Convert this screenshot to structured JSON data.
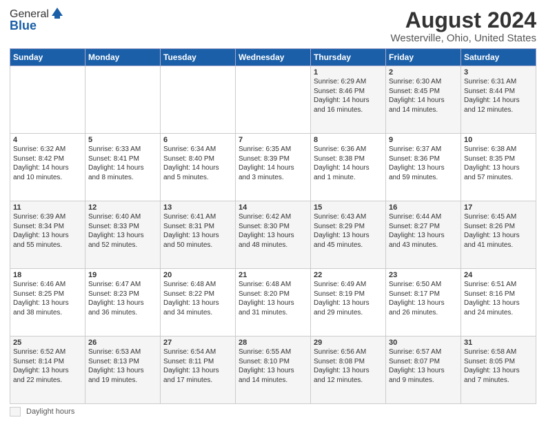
{
  "logo": {
    "general": "General",
    "blue": "Blue"
  },
  "header": {
    "title": "August 2024",
    "subtitle": "Westerville, Ohio, United States"
  },
  "days_of_week": [
    "Sunday",
    "Monday",
    "Tuesday",
    "Wednesday",
    "Thursday",
    "Friday",
    "Saturday"
  ],
  "weeks": [
    [
      {
        "day": "",
        "info": ""
      },
      {
        "day": "",
        "info": ""
      },
      {
        "day": "",
        "info": ""
      },
      {
        "day": "",
        "info": ""
      },
      {
        "day": "1",
        "info": "Sunrise: 6:29 AM\nSunset: 8:46 PM\nDaylight: 14 hours\nand 16 minutes."
      },
      {
        "day": "2",
        "info": "Sunrise: 6:30 AM\nSunset: 8:45 PM\nDaylight: 14 hours\nand 14 minutes."
      },
      {
        "day": "3",
        "info": "Sunrise: 6:31 AM\nSunset: 8:44 PM\nDaylight: 14 hours\nand 12 minutes."
      }
    ],
    [
      {
        "day": "4",
        "info": "Sunrise: 6:32 AM\nSunset: 8:42 PM\nDaylight: 14 hours\nand 10 minutes."
      },
      {
        "day": "5",
        "info": "Sunrise: 6:33 AM\nSunset: 8:41 PM\nDaylight: 14 hours\nand 8 minutes."
      },
      {
        "day": "6",
        "info": "Sunrise: 6:34 AM\nSunset: 8:40 PM\nDaylight: 14 hours\nand 5 minutes."
      },
      {
        "day": "7",
        "info": "Sunrise: 6:35 AM\nSunset: 8:39 PM\nDaylight: 14 hours\nand 3 minutes."
      },
      {
        "day": "8",
        "info": "Sunrise: 6:36 AM\nSunset: 8:38 PM\nDaylight: 14 hours\nand 1 minute."
      },
      {
        "day": "9",
        "info": "Sunrise: 6:37 AM\nSunset: 8:36 PM\nDaylight: 13 hours\nand 59 minutes."
      },
      {
        "day": "10",
        "info": "Sunrise: 6:38 AM\nSunset: 8:35 PM\nDaylight: 13 hours\nand 57 minutes."
      }
    ],
    [
      {
        "day": "11",
        "info": "Sunrise: 6:39 AM\nSunset: 8:34 PM\nDaylight: 13 hours\nand 55 minutes."
      },
      {
        "day": "12",
        "info": "Sunrise: 6:40 AM\nSunset: 8:33 PM\nDaylight: 13 hours\nand 52 minutes."
      },
      {
        "day": "13",
        "info": "Sunrise: 6:41 AM\nSunset: 8:31 PM\nDaylight: 13 hours\nand 50 minutes."
      },
      {
        "day": "14",
        "info": "Sunrise: 6:42 AM\nSunset: 8:30 PM\nDaylight: 13 hours\nand 48 minutes."
      },
      {
        "day": "15",
        "info": "Sunrise: 6:43 AM\nSunset: 8:29 PM\nDaylight: 13 hours\nand 45 minutes."
      },
      {
        "day": "16",
        "info": "Sunrise: 6:44 AM\nSunset: 8:27 PM\nDaylight: 13 hours\nand 43 minutes."
      },
      {
        "day": "17",
        "info": "Sunrise: 6:45 AM\nSunset: 8:26 PM\nDaylight: 13 hours\nand 41 minutes."
      }
    ],
    [
      {
        "day": "18",
        "info": "Sunrise: 6:46 AM\nSunset: 8:25 PM\nDaylight: 13 hours\nand 38 minutes."
      },
      {
        "day": "19",
        "info": "Sunrise: 6:47 AM\nSunset: 8:23 PM\nDaylight: 13 hours\nand 36 minutes."
      },
      {
        "day": "20",
        "info": "Sunrise: 6:48 AM\nSunset: 8:22 PM\nDaylight: 13 hours\nand 34 minutes."
      },
      {
        "day": "21",
        "info": "Sunrise: 6:48 AM\nSunset: 8:20 PM\nDaylight: 13 hours\nand 31 minutes."
      },
      {
        "day": "22",
        "info": "Sunrise: 6:49 AM\nSunset: 8:19 PM\nDaylight: 13 hours\nand 29 minutes."
      },
      {
        "day": "23",
        "info": "Sunrise: 6:50 AM\nSunset: 8:17 PM\nDaylight: 13 hours\nand 26 minutes."
      },
      {
        "day": "24",
        "info": "Sunrise: 6:51 AM\nSunset: 8:16 PM\nDaylight: 13 hours\nand 24 minutes."
      }
    ],
    [
      {
        "day": "25",
        "info": "Sunrise: 6:52 AM\nSunset: 8:14 PM\nDaylight: 13 hours\nand 22 minutes."
      },
      {
        "day": "26",
        "info": "Sunrise: 6:53 AM\nSunset: 8:13 PM\nDaylight: 13 hours\nand 19 minutes."
      },
      {
        "day": "27",
        "info": "Sunrise: 6:54 AM\nSunset: 8:11 PM\nDaylight: 13 hours\nand 17 minutes."
      },
      {
        "day": "28",
        "info": "Sunrise: 6:55 AM\nSunset: 8:10 PM\nDaylight: 13 hours\nand 14 minutes."
      },
      {
        "day": "29",
        "info": "Sunrise: 6:56 AM\nSunset: 8:08 PM\nDaylight: 13 hours\nand 12 minutes."
      },
      {
        "day": "30",
        "info": "Sunrise: 6:57 AM\nSunset: 8:07 PM\nDaylight: 13 hours\nand 9 minutes."
      },
      {
        "day": "31",
        "info": "Sunrise: 6:58 AM\nSunset: 8:05 PM\nDaylight: 13 hours\nand 7 minutes."
      }
    ]
  ],
  "legend": {
    "label": "Daylight hours"
  }
}
